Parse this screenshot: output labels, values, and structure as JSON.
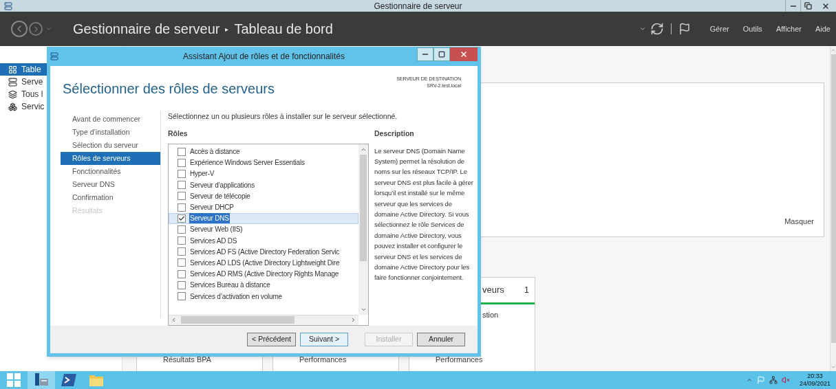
{
  "window": {
    "title": "Gestionnaire de serveur"
  },
  "header": {
    "breadcrumb": [
      "Gestionnaire de serveur",
      "Tableau de bord"
    ],
    "separator": "▸",
    "menu": [
      "Gérer",
      "Outils",
      "Afficher",
      "Aide"
    ]
  },
  "sidebar": {
    "items": [
      {
        "label": "Table",
        "kind": "dashboard",
        "selected": true
      },
      {
        "label": "Serve",
        "kind": "server",
        "selected": false
      },
      {
        "label": "Tous l",
        "kind": "servers",
        "selected": false
      },
      {
        "label": "Servic",
        "kind": "group",
        "selected": false
      }
    ]
  },
  "banner": {
    "link": "Masquer"
  },
  "tiles": [
    {
      "footer": "Résultats BPA"
    },
    {
      "footer": "Performances"
    },
    {
      "title": "veurs",
      "count": "1",
      "item": "stion",
      "footer": "Performances",
      "healthy": true
    }
  ],
  "dialog": {
    "title": "Assistant Ajout de rôles et de fonctionnalités",
    "heading": "Sélectionner des rôles de serveurs",
    "destination_label": "SERVEUR DE DESTINATION",
    "destination_server": "SRV-2.test.local",
    "nav": [
      {
        "label": "Avant de commencer",
        "selected": false,
        "disabled": false
      },
      {
        "label": "Type d’installation",
        "selected": false,
        "disabled": false
      },
      {
        "label": "Sélection du serveur",
        "selected": false,
        "disabled": false
      },
      {
        "label": "Rôles de serveurs",
        "selected": true,
        "disabled": false
      },
      {
        "label": "Fonctionnalités",
        "selected": false,
        "disabled": false
      },
      {
        "label": "Serveur DNS",
        "selected": false,
        "disabled": false
      },
      {
        "label": "Confirmation",
        "selected": false,
        "disabled": false
      },
      {
        "label": "Résultats",
        "selected": false,
        "disabled": true
      }
    ],
    "instruction": "Sélectionnez un ou plusieurs rôles à installer sur le serveur sélectionné.",
    "roles_label": "Rôles",
    "roles": [
      {
        "label": "Accès à distance",
        "checked": false,
        "selected": false
      },
      {
        "label": "Expérience Windows Server Essentials",
        "checked": false,
        "selected": false
      },
      {
        "label": "Hyper-V",
        "checked": false,
        "selected": false
      },
      {
        "label": "Serveur d’applications",
        "checked": false,
        "selected": false
      },
      {
        "label": "Serveur de télécopie",
        "checked": false,
        "selected": false
      },
      {
        "label": "Serveur DHCP",
        "checked": false,
        "selected": false
      },
      {
        "label": "Serveur DNS",
        "checked": true,
        "selected": true
      },
      {
        "label": "Serveur Web (IIS)",
        "checked": false,
        "selected": false
      },
      {
        "label": "Services AD DS",
        "checked": false,
        "selected": false
      },
      {
        "label": "Services AD FS (Active Directory Federation Servic",
        "checked": false,
        "selected": false
      },
      {
        "label": "Services AD LDS (Active Directory Lightweight Dire",
        "checked": false,
        "selected": false
      },
      {
        "label": "Services AD RMS (Active Directory Rights Manage",
        "checked": false,
        "selected": false
      },
      {
        "label": "Services Bureau à distance",
        "checked": false,
        "selected": false
      },
      {
        "label": "Services d’activation en volume",
        "checked": false,
        "selected": false
      }
    ],
    "description_label": "Description",
    "description": "Le serveur DNS (Domain Name System) permet la résolution de noms sur les réseaux TCP/IP. Le serveur DNS est plus facile à gérer lorsqu’il est installé sur le même serveur que les services de domaine Active Directory. Si vous sélectionnez le rôle Services de domaine Active Directory, vous pouvez installer et configurer le serveur DNS et les services de domaine Active Directory pour les faire fonctionner conjointement.",
    "buttons": [
      {
        "label": "< Précédent",
        "disabled": false,
        "focused": false
      },
      {
        "label": "Suivant >",
        "disabled": false,
        "focused": true
      },
      {
        "label": "Installer",
        "disabled": true,
        "focused": false
      },
      {
        "label": "Annuler",
        "disabled": false,
        "focused": false
      }
    ]
  },
  "taskbar": {
    "apps": [
      {
        "kind": "start",
        "selected": false
      },
      {
        "kind": "server-manager",
        "selected": true
      },
      {
        "kind": "powershell",
        "selected": false
      },
      {
        "kind": "explorer",
        "selected": false
      }
    ],
    "time": "20:33",
    "date": "24/09/2021"
  }
}
